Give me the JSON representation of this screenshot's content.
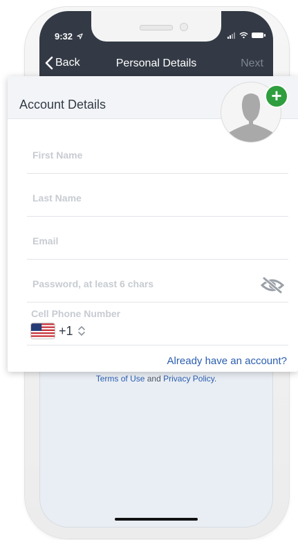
{
  "status_bar": {
    "time": "9:32",
    "icons": [
      "location-arrow-icon",
      "signal-icon",
      "wifi-icon",
      "battery-icon"
    ]
  },
  "nav_bar": {
    "back_label": "Back",
    "title": "Personal Details",
    "next_label": "Next"
  },
  "card": {
    "title": "Account Details",
    "fields": {
      "first_name": {
        "placeholder": "First Name",
        "value": ""
      },
      "last_name": {
        "placeholder": "Last Name",
        "value": ""
      },
      "email": {
        "placeholder": "Email",
        "value": ""
      },
      "password": {
        "placeholder": "Password, at least 6 chars",
        "value": ""
      },
      "phone": {
        "label": "Cell Phone Number",
        "country_code": "+1",
        "flag": "us-flag-icon"
      }
    },
    "login_link": "Already have an account?"
  },
  "terms": {
    "link_terms": "Terms of Use",
    "connector": " and ",
    "link_privacy": "Privacy Policy",
    "end": "."
  },
  "colors": {
    "nav_background": "#333a45",
    "link": "#2a5db0",
    "add_photo": "#2e9e3e"
  }
}
